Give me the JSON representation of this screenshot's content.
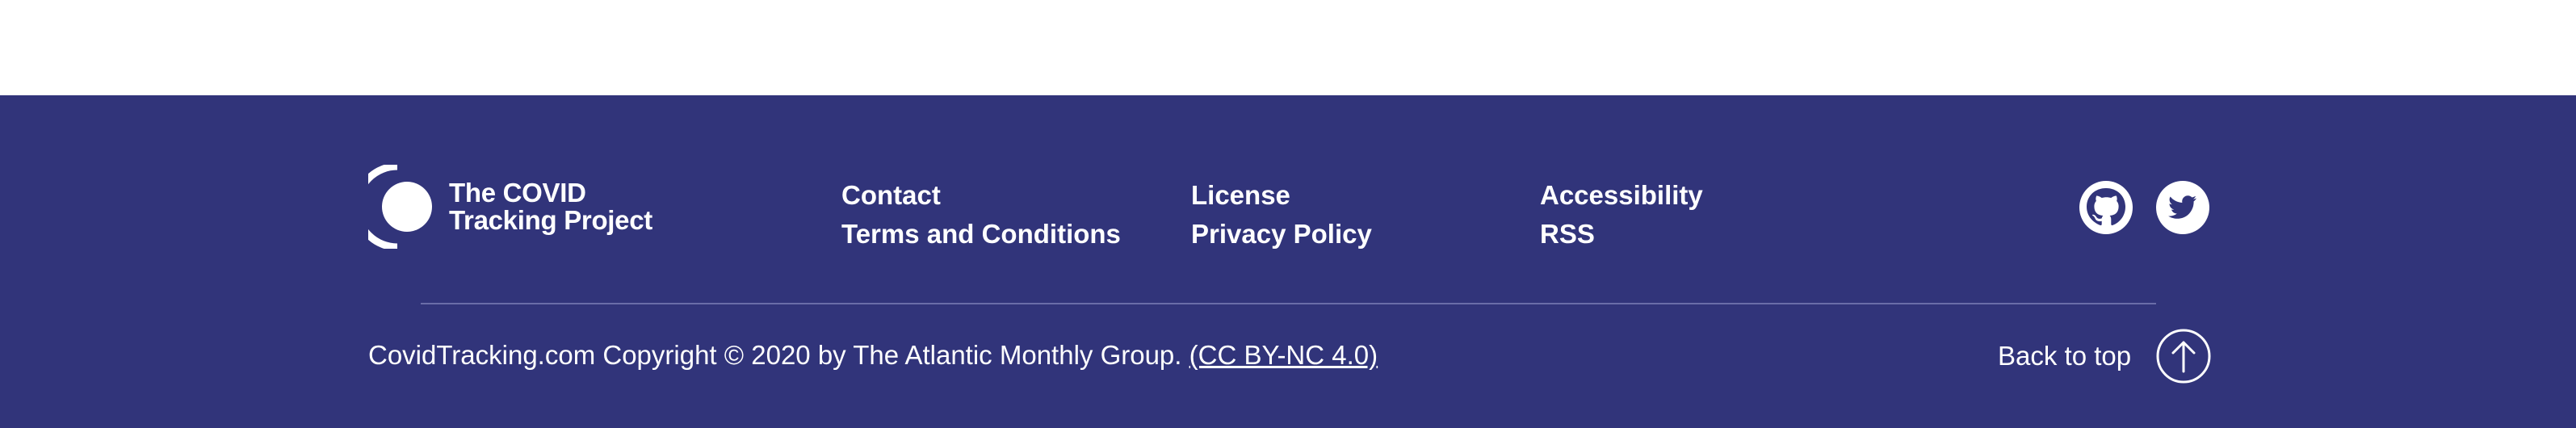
{
  "logo": {
    "line1": "The COVID",
    "line2": "Tracking Project"
  },
  "nav": {
    "col1": [
      "Contact",
      "Terms and Conditions"
    ],
    "col2": [
      "License",
      "Privacy Policy"
    ],
    "col3": [
      "Accessibility",
      "RSS"
    ]
  },
  "social": {
    "github_icon": "github-icon",
    "twitter_icon": "twitter-icon"
  },
  "footer": {
    "copyright": "CovidTracking.com Copyright © 2020 by The Atlantic Monthly Group.",
    "license_link": "(CC BY-NC 4.0)",
    "back_to_top": "Back to top",
    "back_to_top_icon": "arrow-up-circle-icon"
  },
  "colors": {
    "footer_background": "#31347a",
    "text": "#ffffff",
    "divider": "#6a6da8"
  }
}
